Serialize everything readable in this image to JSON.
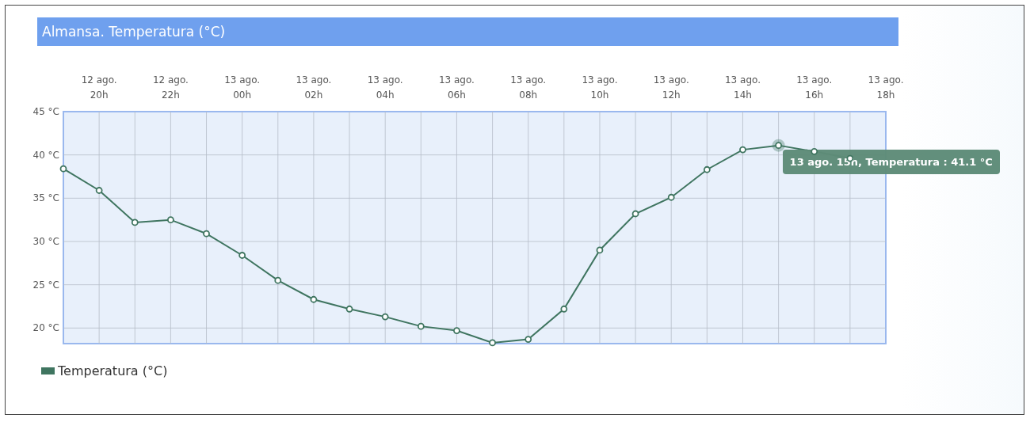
{
  "title": "Almansa. Temperatura (°C)",
  "chart_data": {
    "type": "line",
    "categories": [
      null,
      "12 ago. 20h",
      null,
      "12 ago. 22h",
      null,
      "13 ago. 00h",
      null,
      "13 ago. 02h",
      null,
      "13 ago. 04h",
      null,
      "13 ago. 06h",
      null,
      "13 ago. 08h",
      null,
      "13 ago. 10h",
      null,
      "13 ago. 12h",
      null,
      "13 ago. 14h",
      null,
      "13 ago. 16h",
      null,
      "13 ago. 18h"
    ],
    "ylim": [
      18.2,
      45
    ],
    "grid": true,
    "yticks": [
      {
        "value": 20,
        "label": "20 °C"
      },
      {
        "value": 25,
        "label": "25 °C"
      },
      {
        "value": 30,
        "label": "30 °C"
      },
      {
        "value": 35,
        "label": "35 °C"
      },
      {
        "value": 40,
        "label": "40 °C"
      },
      {
        "value": 45,
        "label": "45 °C"
      }
    ],
    "series": [
      {
        "name": "Temperatura (°C)",
        "color": "#3f7560",
        "marker": true,
        "values": [
          38.4,
          35.9,
          32.2,
          32.5,
          30.9,
          28.4,
          25.5,
          23.3,
          22.2,
          21.3,
          20.2,
          19.7,
          18.3,
          18.7,
          22.2,
          29.0,
          33.2,
          35.1,
          38.3,
          40.6,
          41.1,
          40.4,
          39.6,
          null
        ]
      }
    ],
    "annotations": [
      "13 ago. 15h, Temperatura : 41.1 °C"
    ]
  }
}
